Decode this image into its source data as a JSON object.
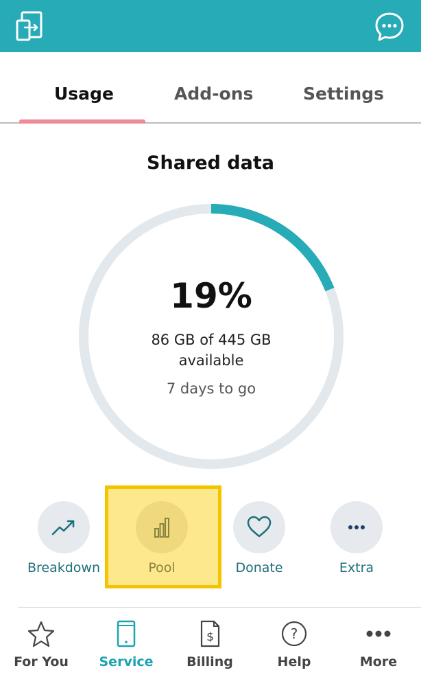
{
  "header": {
    "left_icon": "device-switch-icon",
    "right_icon": "chat-bubble-icon"
  },
  "tabs": [
    {
      "label": "Usage",
      "active": true
    },
    {
      "label": "Add-ons",
      "active": false
    },
    {
      "label": "Settings",
      "active": false
    }
  ],
  "usage": {
    "title": "Shared data",
    "percent_label": "19%",
    "percent_value": 19,
    "gb_line1": "86 GB of 445 GB",
    "gb_line2": "available",
    "days_left": "7 days to go"
  },
  "actions": [
    {
      "label": "Breakdown",
      "icon": "trend-up-icon"
    },
    {
      "label": "Pool",
      "icon": "bar-chart-icon",
      "highlighted": true
    },
    {
      "label": "Donate",
      "icon": "heart-icon"
    },
    {
      "label": "Extra",
      "icon": "more-dots-icon"
    }
  ],
  "bottom_nav": [
    {
      "label": "For You",
      "icon": "star-icon",
      "active": false
    },
    {
      "label": "Service",
      "icon": "phone-icon",
      "active": true
    },
    {
      "label": "Billing",
      "icon": "bill-icon",
      "active": false
    },
    {
      "label": "Help",
      "icon": "help-icon",
      "active": false
    },
    {
      "label": "More",
      "icon": "more-dots-icon",
      "active": false
    }
  ],
  "colors": {
    "accent": "#26abb7",
    "tab_underline": "#ee8b99",
    "highlight_fill": "#fde98c",
    "highlight_border": "#f5c400",
    "ring_track": "#e3e8ec"
  }
}
